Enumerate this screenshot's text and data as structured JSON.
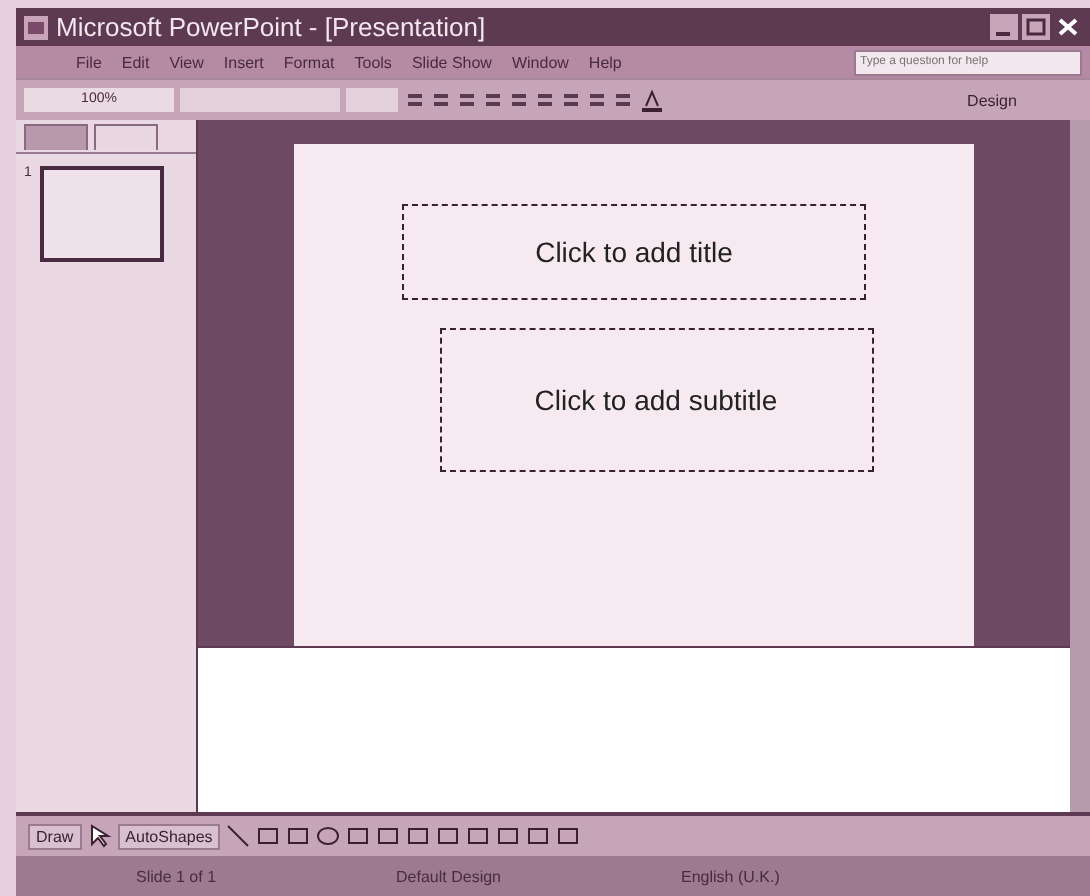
{
  "window": {
    "title": "Microsoft PowerPoint - [Presentation]"
  },
  "menu": [
    "File",
    "Edit",
    "View",
    "Insert",
    "Format",
    "Tools",
    "Slide Show",
    "Window",
    "Help"
  ],
  "help_box": {
    "placeholder": "Type a question for help"
  },
  "toolbar": {
    "zoom": "100%",
    "design": "Design"
  },
  "slides_pane": {
    "tabs": [
      {
        "selected": false
      },
      {
        "selected": true
      }
    ],
    "thumbnails": [
      {
        "number": "1",
        "selected": true
      }
    ]
  },
  "slide": {
    "title_placeholder": "Click to add title",
    "subtitle_placeholder": "Click to add subtitle"
  },
  "drawing_toolbar": {
    "draw": "Draw",
    "autoshapes": "AutoShapes"
  },
  "status_bar": [
    "Slide 1 of 1",
    "Default Design",
    "English (U.K.)"
  ]
}
